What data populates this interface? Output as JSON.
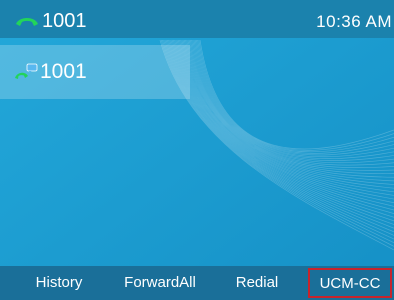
{
  "status_bar": {
    "account_icon": "phone-handset-icon",
    "account_label": "1001",
    "time": "10:36 AM",
    "accent_color": "#22d45a"
  },
  "line_key": {
    "icon": "line-status-icon",
    "label": "1001"
  },
  "softkeys": [
    {
      "label": "History"
    },
    {
      "label": "ForwardAll"
    },
    {
      "label": "Redial"
    },
    {
      "label": "UCM-CC",
      "highlighted": true
    }
  ],
  "colors": {
    "background": "#1b9fd2",
    "status_bar": "#1b82ad",
    "softkey_bar": "#1a6f99",
    "highlight_border": "#c8242c"
  }
}
